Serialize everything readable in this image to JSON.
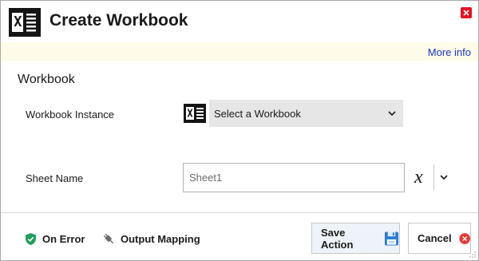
{
  "window": {
    "title": "Create Workbook",
    "close_icon": "close-icon",
    "app_icon": "excel-icon"
  },
  "info_bar": {
    "more_info": "More info"
  },
  "section": {
    "title": "Workbook"
  },
  "fields": {
    "workbook_instance": {
      "label": "Workbook Instance",
      "icon": "excel-icon",
      "selected_value": "Select a Workbook"
    },
    "sheet_name": {
      "label": "Sheet Name",
      "value": "Sheet1",
      "variable_button_glyph": "x"
    }
  },
  "footer": {
    "on_error": "On Error",
    "output_mapping": "Output Mapping",
    "save_action": "Save Action",
    "cancel": "Cancel"
  },
  "colors": {
    "accent_link": "#1a33c7",
    "close_red": "#e81123",
    "info_bar_bg": "#fefbe8",
    "shield_green": "#1e9e5a",
    "save_icon_blue": "#2b7cd3"
  }
}
